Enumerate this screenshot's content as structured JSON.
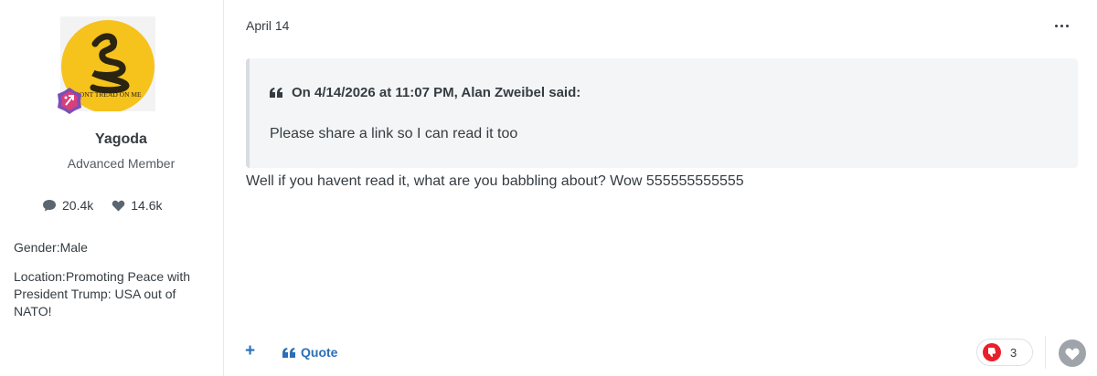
{
  "author": {
    "name": "Yagoda",
    "rank": "Advanced Member",
    "avatar_text": "DONT TREAD ON ME",
    "stats": {
      "posts": "20.4k",
      "reputation": "14.6k"
    },
    "gender": "Gender:Male",
    "location": "Location:Promoting Peace with President Trump: USA out of NATO!"
  },
  "post": {
    "date": "April 14",
    "quote": {
      "citation": "On 4/14/2026 at 11:07 PM, Alan Zweibel said:",
      "text": "Please share a link so I can read it too"
    },
    "body": "Well if you havent read it, what are you babbling about? Wow 555555555555"
  },
  "actions": {
    "plus": "+",
    "quote_label": "Quote",
    "reaction_count": "3"
  },
  "icons": {
    "posts": "speech-bubble-icon",
    "reputation": "heart-icon",
    "more": "ellipsis-icon",
    "quote": "quote-mark-icon",
    "reaction": "thumbs-down-icon",
    "like": "heart-icon",
    "badge": "rank-badge-icon"
  },
  "colors": {
    "link": "#2a6fb7",
    "text": "#353c41",
    "quote_bg": "#f3f5f7",
    "avatar_yellow": "#f6c21c",
    "reaction_red": "#e8202a"
  }
}
